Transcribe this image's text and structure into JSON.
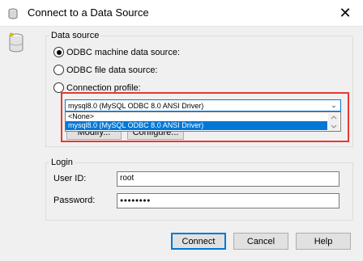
{
  "window": {
    "title": "Connect to a Data Source",
    "close_glyph": "✕"
  },
  "data_source": {
    "group_label": "Data source",
    "option_machine": "ODBC machine data source:",
    "option_file": "ODBC file data source:",
    "option_profile": "Connection profile:",
    "selected_option": "machine",
    "combo_value": "mysql8.0 (MySQL ODBC 8.0 ANSI Driver)",
    "dropdown_items": [
      "<None>",
      "mysql8.0 (MySQL ODBC 8.0 ANSI Driver)"
    ],
    "modify_label": "Modify...",
    "configure_label": "Configure..."
  },
  "login": {
    "group_label": "Login",
    "user_id_label": "User ID:",
    "user_id_value": "root",
    "password_label": "Password:",
    "password_value": "●●●●●●●●"
  },
  "buttons": {
    "connect": "Connect",
    "cancel": "Cancel",
    "help": "Help"
  },
  "colors": {
    "accent": "#0078d7",
    "highlight_box": "#e53935",
    "dialog_bg": "#f0f0f0"
  },
  "icons": {
    "app": "database-icon",
    "dialog": "database-cylinder-icon"
  }
}
